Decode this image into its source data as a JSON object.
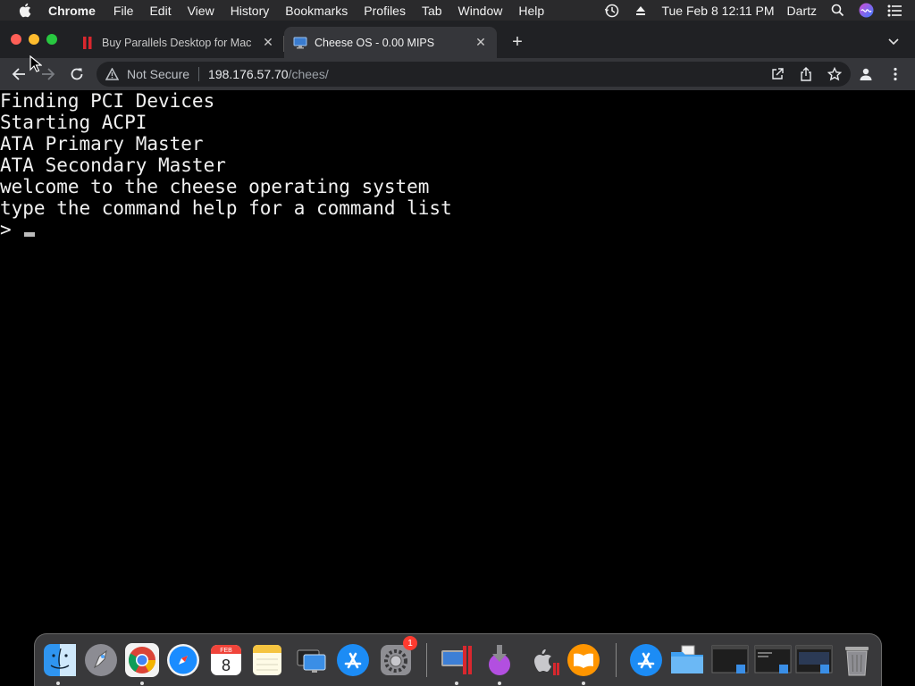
{
  "menubar": {
    "app_name": "Chrome",
    "items": [
      "File",
      "Edit",
      "View",
      "History",
      "Bookmarks",
      "Profiles",
      "Tab",
      "Window",
      "Help"
    ],
    "datetime": "Tue Feb 8  12:11 PM",
    "user": "Dartz"
  },
  "tabs": [
    {
      "title": "Buy Parallels Desktop for Mac",
      "active": false,
      "favicon": "parallels-icon"
    },
    {
      "title": "Cheese OS - 0.00 MIPS",
      "active": true,
      "favicon": "monitor-icon"
    }
  ],
  "omnibox": {
    "security_label": "Not Secure",
    "host": "198.176.57.70",
    "path": "/chees/"
  },
  "terminal": {
    "lines": [
      "Finding PCI Devices",
      "Starting ACPI",
      "ATA Primary Master",
      "ATA Secondary Master",
      "welcome to the cheese operating system",
      "type the command help for a command list"
    ],
    "prompt": ">"
  },
  "dock": {
    "apps": [
      "finder-icon",
      "launchpad-icon",
      "chrome-icon",
      "safari-icon",
      "calendar-icon",
      "notes-icon",
      "screen-sharing-icon",
      "app-store-icon",
      "system-preferences-icon",
      "parallels-desktop-icon",
      "parallels-vm-icon",
      "installer-icon",
      "boot-camp-icon",
      "books-icon",
      "app-store-folder-icon",
      "folder-icon",
      "window-thumbnail-icon",
      "window-thumbnail-icon",
      "window-thumbnail-icon",
      "trash-icon"
    ],
    "calendar": {
      "month": "FEB",
      "day": "8"
    },
    "badge": "1"
  },
  "colors": {
    "menubar_bg": "#2a2a2c",
    "tabstrip_bg": "#202124",
    "toolbar_bg": "#35363a",
    "terminal_bg": "#000000",
    "terminal_fg": "#f0f0f0"
  }
}
